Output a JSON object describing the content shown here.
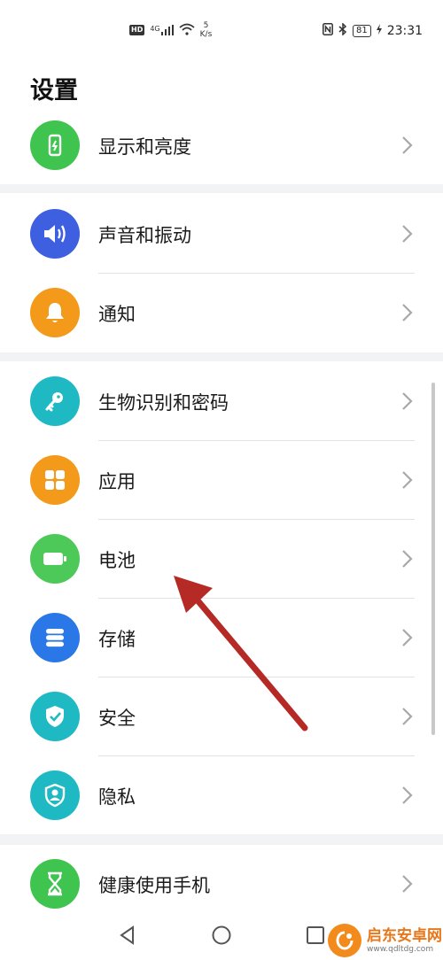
{
  "status_bar": {
    "hd": "HD",
    "network": "4G",
    "speed_value": "5",
    "speed_unit": "K/s",
    "battery": "81",
    "time": "23:31"
  },
  "page": {
    "title": "设置"
  },
  "groups": [
    {
      "items": [
        {
          "label": "显示和亮度",
          "icon": "display-icon",
          "color": "#3fc44f"
        }
      ]
    },
    {
      "items": [
        {
          "label": "声音和振动",
          "icon": "sound-icon",
          "color": "#3d5fe0"
        },
        {
          "label": "通知",
          "icon": "bell-icon",
          "color": "#f39a1a"
        }
      ]
    },
    {
      "items": [
        {
          "label": "生物识别和密码",
          "icon": "key-icon",
          "color": "#1fb9c4"
        },
        {
          "label": "应用",
          "icon": "apps-icon",
          "color": "#f39a1a"
        },
        {
          "label": "电池",
          "icon": "battery-icon",
          "color": "#4dc95a"
        },
        {
          "label": "存储",
          "icon": "storage-icon",
          "color": "#2a78e8"
        },
        {
          "label": "安全",
          "icon": "shield-icon",
          "color": "#1fb9c4"
        },
        {
          "label": "隐私",
          "icon": "privacy-icon",
          "color": "#1fb9c4"
        }
      ]
    },
    {
      "items": [
        {
          "label": "健康使用手机",
          "icon": "hourglass-icon",
          "color": "#3fc44f"
        }
      ]
    }
  ],
  "watermark": {
    "title": "启东安卓网",
    "url": "www.qdltdg.com"
  }
}
